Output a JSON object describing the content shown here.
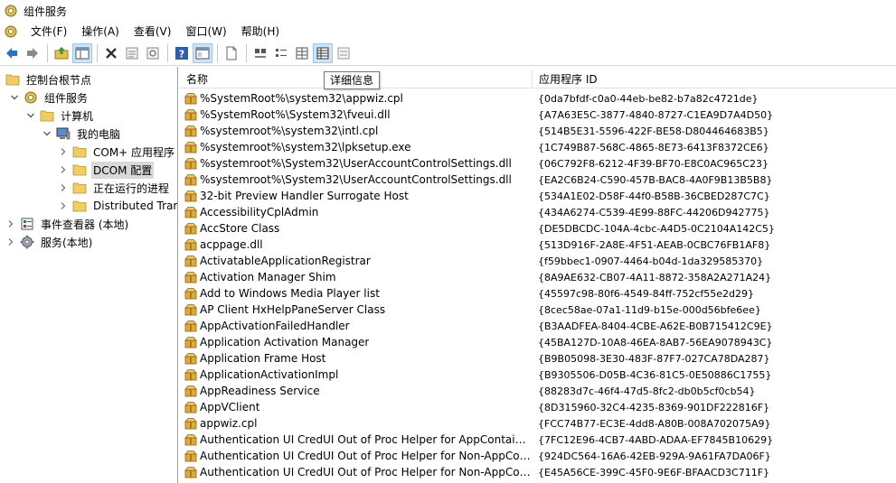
{
  "window": {
    "title": "组件服务",
    "icon": "component-services-icon"
  },
  "menu": [
    {
      "label": "文件(F)"
    },
    {
      "label": "操作(A)"
    },
    {
      "label": "查看(V)"
    },
    {
      "label": "窗口(W)"
    },
    {
      "label": "帮助(H)"
    }
  ],
  "toolbar": {
    "tooltip": "详细信息",
    "buttons": [
      "back-arrow-icon",
      "forward-arrow-icon",
      "up-folder-icon",
      "show-hide-tree-icon",
      "delete-icon",
      "properties-icon",
      "refresh-icon",
      "help-icon",
      "console-tree-icon",
      "new-icon",
      "large-icons-icon",
      "small-icons-icon",
      "list-view-icon",
      "details-view-icon",
      "status-view-icon"
    ]
  },
  "tree": [
    {
      "label": "控制台根节点",
      "level": 0,
      "expander": "none",
      "icon": "folder-icon",
      "selected": false
    },
    {
      "label": "组件服务",
      "level": 1,
      "expander": "expanded",
      "icon": "component-services-icon",
      "selected": false
    },
    {
      "label": "计算机",
      "level": 2,
      "expander": "expanded",
      "icon": "folder-icon",
      "selected": false
    },
    {
      "label": "我的电脑",
      "level": 3,
      "expander": "expanded",
      "icon": "computer-icon",
      "selected": false
    },
    {
      "label": "COM+ 应用程序",
      "level": 4,
      "expander": "collapsed",
      "icon": "folder-icon",
      "selected": false
    },
    {
      "label": "DCOM 配置",
      "level": 4,
      "expander": "collapsed",
      "icon": "folder-icon",
      "selected": true
    },
    {
      "label": "正在运行的进程",
      "level": 4,
      "expander": "collapsed",
      "icon": "folder-icon",
      "selected": false
    },
    {
      "label": "Distributed Trar",
      "level": 4,
      "expander": "collapsed",
      "icon": "folder-icon",
      "selected": false
    },
    {
      "label": "事件查看器 (本地)",
      "level": 0,
      "expander": "collapsed",
      "icon": "event-viewer-icon",
      "selected": false
    },
    {
      "label": "服务(本地)",
      "level": 0,
      "expander": "collapsed",
      "icon": "services-gear-icon",
      "selected": false
    }
  ],
  "list": {
    "columns": {
      "name": "名称",
      "appid": "应用程序 ID"
    },
    "rows": [
      {
        "name": "%SystemRoot%\\system32\\appwiz.cpl",
        "appid": "{0da7bfdf-c0a0-44eb-be82-b7a82c4721de}"
      },
      {
        "name": "%SystemRoot%\\System32\\fveui.dll",
        "appid": "{A7A63E5C-3877-4840-8727-C1EA9D7A4D50}"
      },
      {
        "name": "%systemroot%\\system32\\intl.cpl",
        "appid": "{514B5E31-5596-422F-BE58-D804464683B5}"
      },
      {
        "name": "%systemroot%\\system32\\lpksetup.exe",
        "appid": "{1C749B87-568C-4865-8E73-6413F8372CE6}"
      },
      {
        "name": "%systemroot%\\System32\\UserAccountControlSettings.dll",
        "appid": "{06C792F8-6212-4F39-BF70-E8C0AC965C23}"
      },
      {
        "name": "%systemroot%\\System32\\UserAccountControlSettings.dll",
        "appid": "{EA2C6B24-C590-457B-BAC8-4A0F9B13B5B8}"
      },
      {
        "name": "32-bit Preview Handler Surrogate Host",
        "appid": "{534A1E02-D58F-44f0-B58B-36CBED287C7C}"
      },
      {
        "name": "AccessibilityCplAdmin",
        "appid": "{434A6274-C539-4E99-88FC-44206D942775}"
      },
      {
        "name": "AccStore Class",
        "appid": "{DE5DBCDC-104A-4cbc-A4D5-0C2104A142C5}"
      },
      {
        "name": "acppage.dll",
        "appid": "{513D916F-2A8E-4F51-AEAB-0CBC76FB1AF8}"
      },
      {
        "name": "ActivatableApplicationRegistrar",
        "appid": "{f59bbec1-0907-4464-b04d-1da329585370}"
      },
      {
        "name": "Activation Manager Shim",
        "appid": "{8A9AE632-CB07-4A11-8872-358A2A271A24}"
      },
      {
        "name": "Add to Windows Media Player list",
        "appid": "{45597c98-80f6-4549-84ff-752cf55e2d29}"
      },
      {
        "name": "AP Client HxHelpPaneServer Class",
        "appid": "{8cec58ae-07a1-11d9-b15e-000d56bfe6ee}"
      },
      {
        "name": "AppActivationFailedHandler",
        "appid": "{B3AADFEA-8404-4CBE-A62E-B0B715412C9E}"
      },
      {
        "name": "Application Activation Manager",
        "appid": "{45BA127D-10A8-46EA-8AB7-56EA9078943C}"
      },
      {
        "name": "Application Frame Host",
        "appid": "{B9B05098-3E30-483F-87F7-027CA78DA287}"
      },
      {
        "name": "ApplicationActivationImpl",
        "appid": "{B9305506-D05B-4C36-81C5-0E50886C1755}"
      },
      {
        "name": "AppReadiness Service",
        "appid": "{88283d7c-46f4-47d5-8fc2-db0b5cf0cb54}"
      },
      {
        "name": "AppVClient",
        "appid": "{8D315960-32C4-4235-8369-901DF222816F}"
      },
      {
        "name": "appwiz.cpl",
        "appid": "{FCC74B77-EC3E-4dd8-A80B-008A702075A9}"
      },
      {
        "name": "Authentication UI CredUI Out of Proc Helper for AppContainer Clients",
        "appid": "{7FC12E96-4CB7-4ABD-ADAA-EF7845B10629}"
      },
      {
        "name": "Authentication UI CredUI Out of Proc Helper for Non-AppContainer Clients",
        "appid": "{924DC564-16A6-42EB-929A-9A61FA7DA06F}"
      },
      {
        "name": "Authentication UI CredUI Out of Proc Helper for Non-AppContainer Clients",
        "appid": "{E45A56CE-399C-45F0-9E6F-BFAACD3C711F}"
      }
    ]
  }
}
